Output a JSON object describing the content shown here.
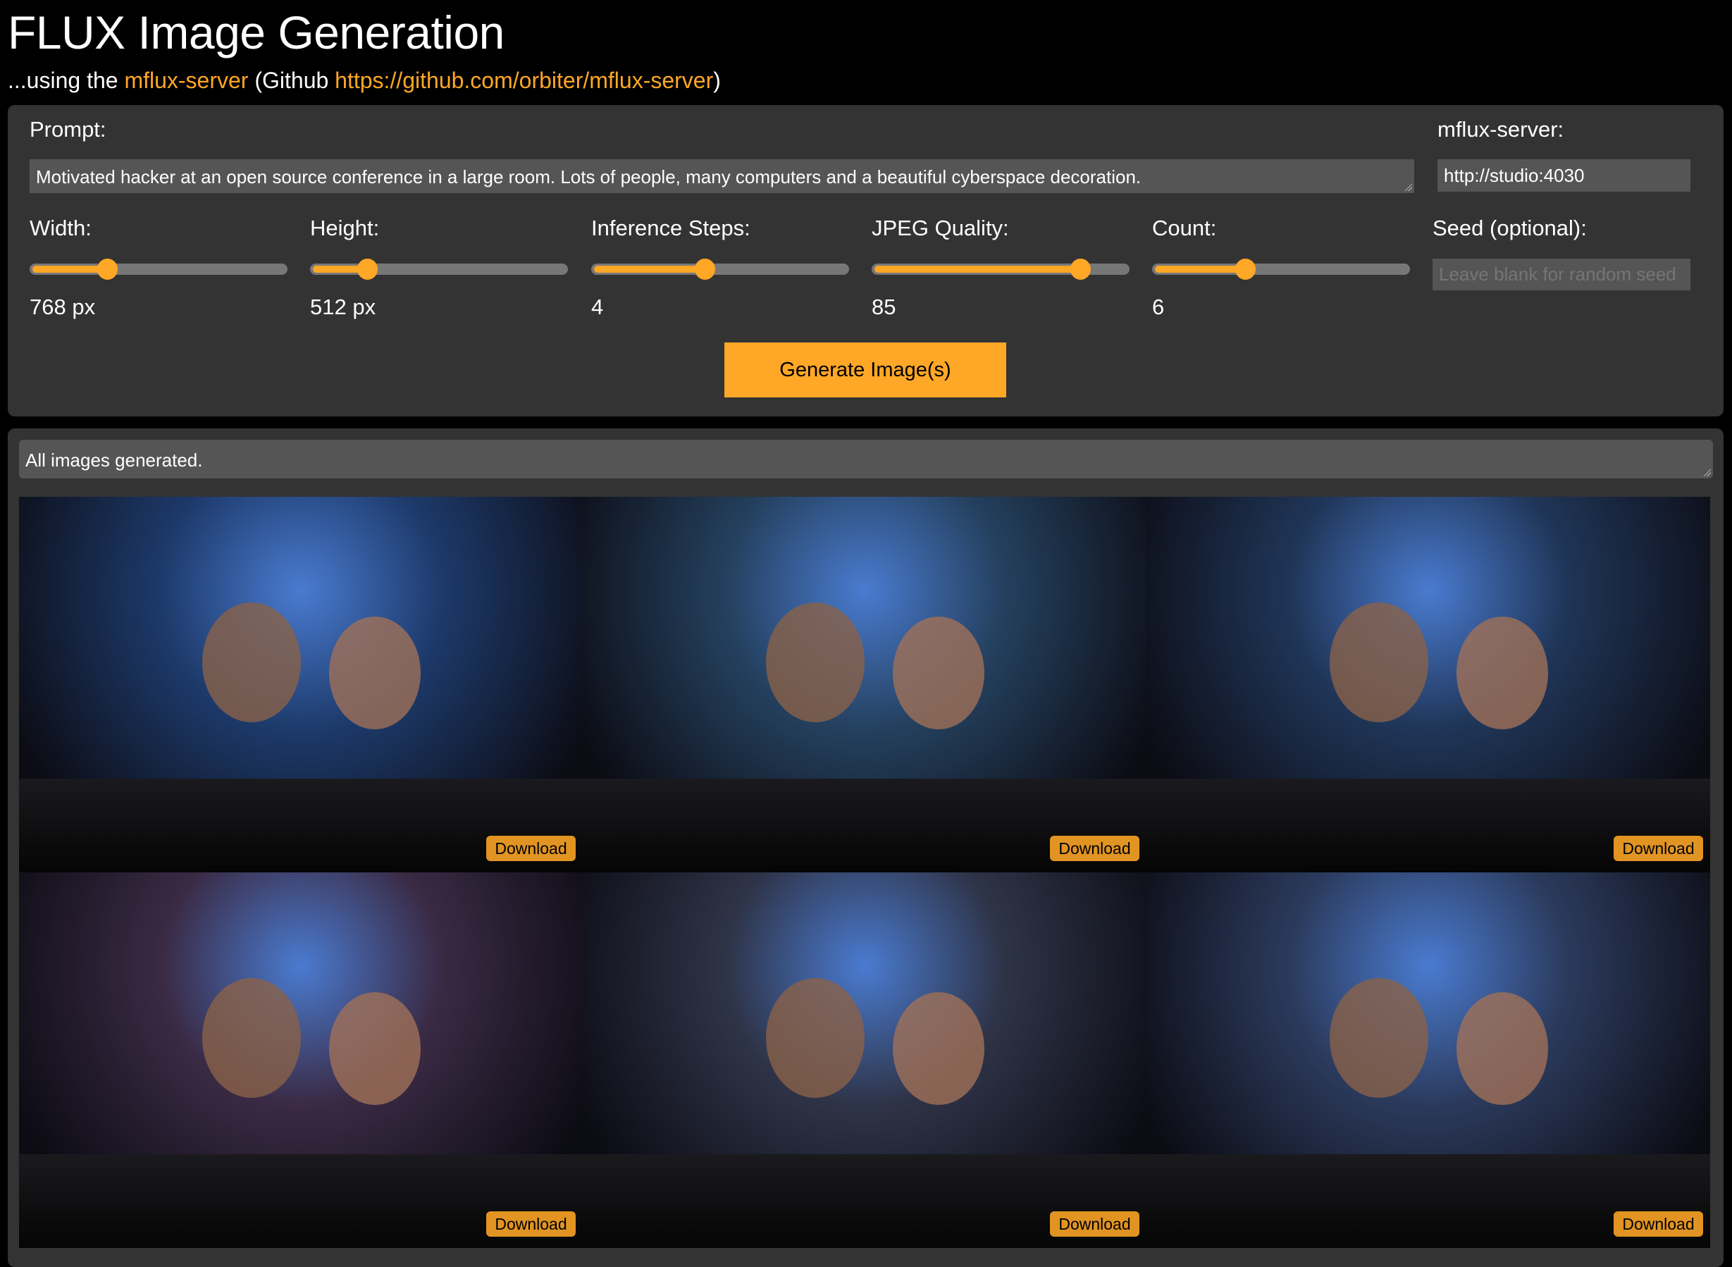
{
  "header": {
    "title": "FLUX Image Generation",
    "subtitle_prefix": "...using the ",
    "subtitle_link": "mflux-server",
    "subtitle_mid": " (Github ",
    "github_link": "https://github.com/orbiter/mflux-server",
    "subtitle_suffix": ")"
  },
  "form": {
    "prompt_label": "Prompt:",
    "prompt_value": "Motivated hacker at an open source conference in a large room. Lots of people, many computers and a beautiful cyberspace decoration.",
    "server_label": "mflux-server:",
    "server_value": "http://studio:4030",
    "sliders": [
      {
        "label": "Width:",
        "value": "768 px",
        "fill_percent": 30
      },
      {
        "label": "Height:",
        "value": "512 px",
        "fill_percent": 22
      },
      {
        "label": "Inference Steps:",
        "value": "4",
        "fill_percent": 44
      },
      {
        "label": "JPEG Quality:",
        "value": "85",
        "fill_percent": 81
      },
      {
        "label": "Count:",
        "value": "6",
        "fill_percent": 36
      }
    ],
    "seed_label": "Seed (optional):",
    "seed_placeholder": "Leave blank for random seed",
    "generate_label": "Generate Image(s)"
  },
  "results": {
    "status": "All images generated.",
    "images": [
      {
        "download_label": "Download",
        "tone": "#1d3a6b"
      },
      {
        "download_label": "Download",
        "tone": "#24405e"
      },
      {
        "download_label": "Download",
        "tone": "#1f3557"
      },
      {
        "download_label": "Download",
        "tone": "#3a2a44"
      },
      {
        "download_label": "Download",
        "tone": "#2e3347"
      },
      {
        "download_label": "Download",
        "tone": "#2b3a5c"
      }
    ]
  },
  "colors": {
    "accent": "#ffa726",
    "panel": "#333333",
    "field": "#555555"
  }
}
